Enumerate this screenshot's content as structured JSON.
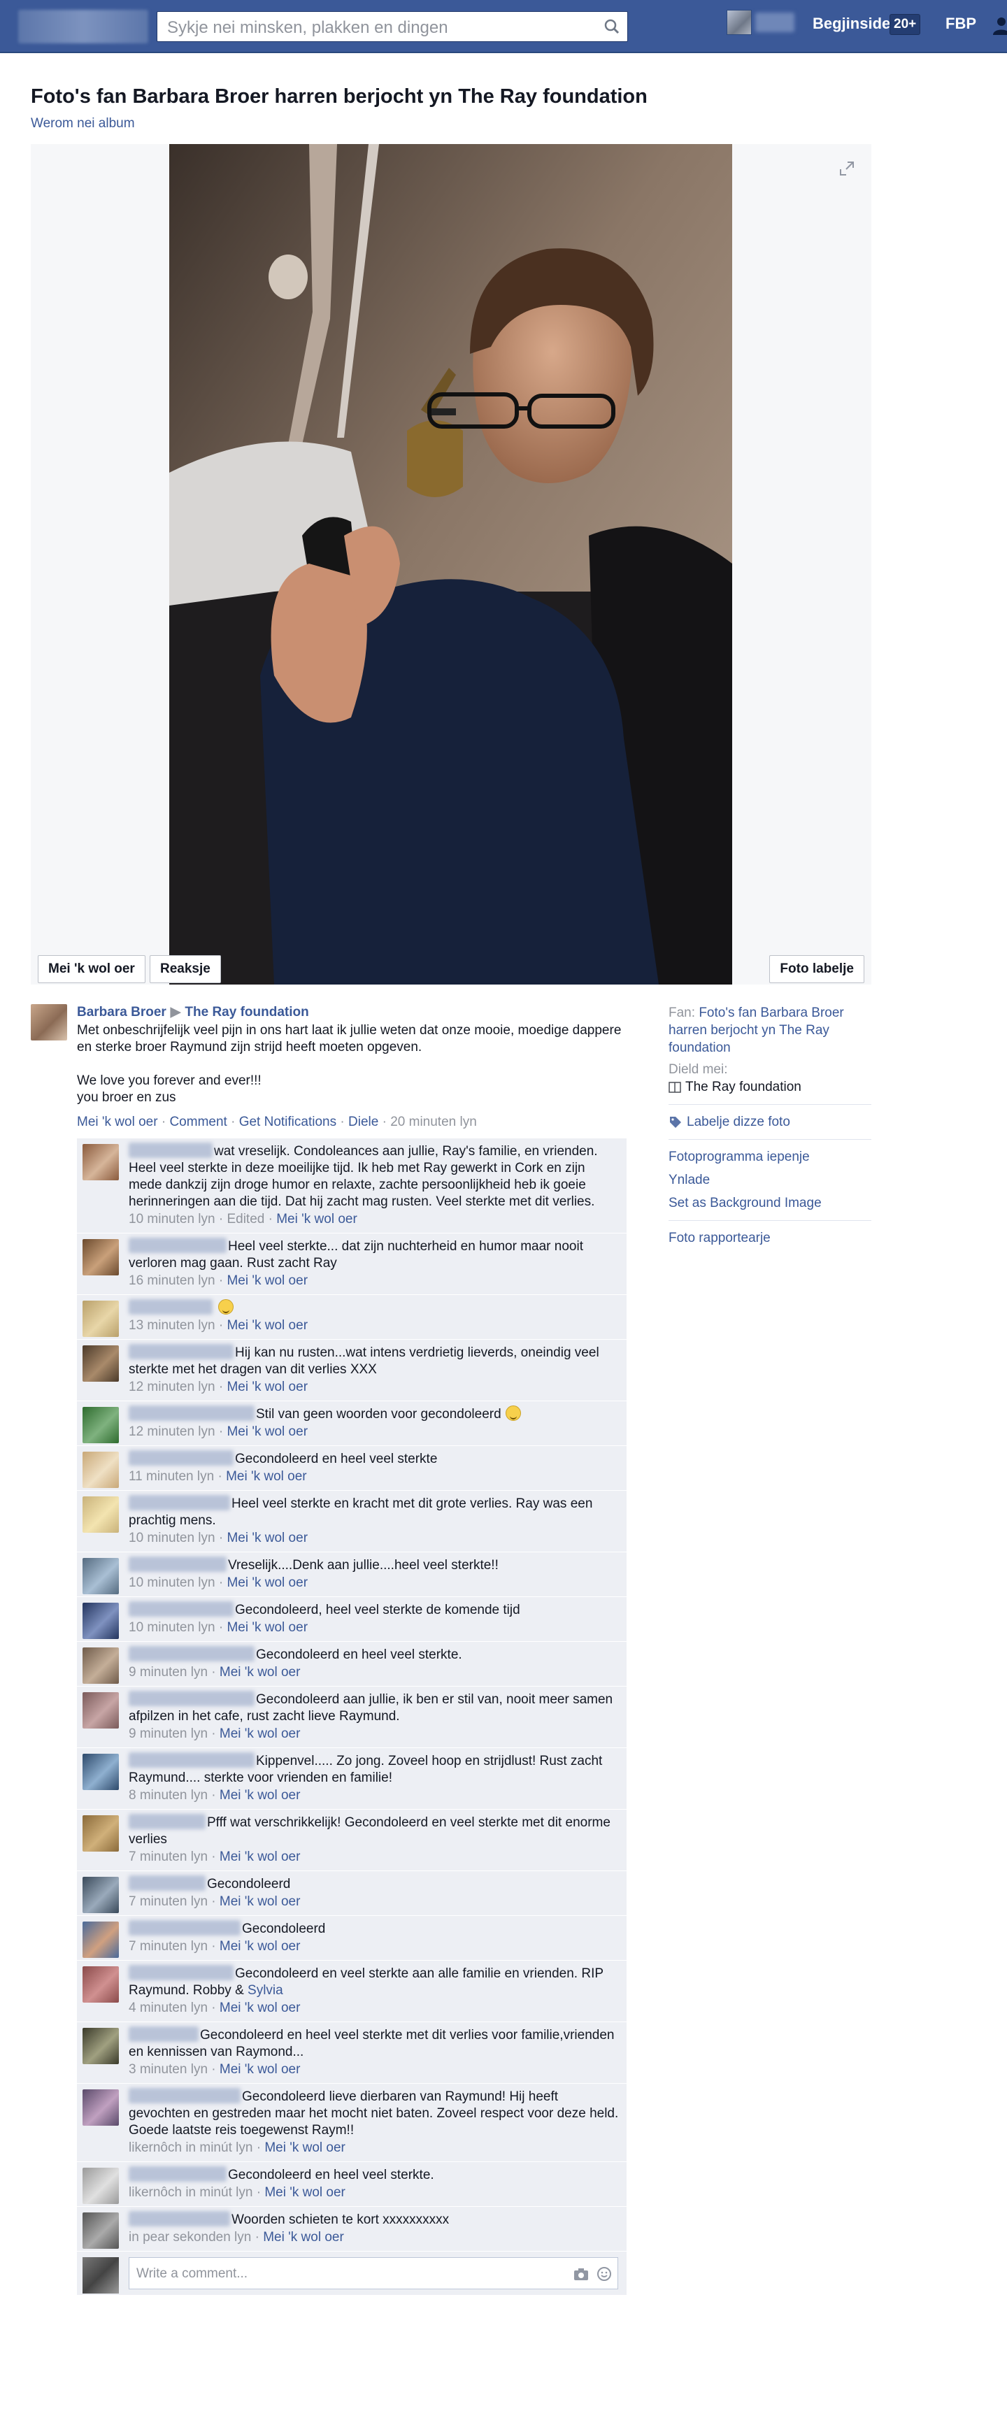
{
  "topbar": {
    "search_placeholder": "Sykje nei minsken, plakken en dingen",
    "home_label": "Begjinside",
    "home_badge": "20+",
    "profile_short": "FBP"
  },
  "header": {
    "title": "Foto's fan Barbara Broer harren berjocht yn The Ray foundation",
    "back_link": "Werom nei album"
  },
  "photo_actions": {
    "like": "Mei 'k wol oer",
    "react": "Reaksje",
    "tag": "Foto labelje"
  },
  "post": {
    "author": "Barbara Broer",
    "arrow": "▶",
    "group": "The Ray foundation",
    "body": "Met onbeschrijfelijk veel pijn in ons hart laat ik jullie weten dat onze mooie, moedige dappere en sterke broer Raymund zijn strijd heeft moeten opgeven.\n\nWe love you forever and ever!!!\nyou broer en zus",
    "actions": {
      "like": "Mei 'k wol oer",
      "comment": "Comment",
      "notifications": "Get Notifications",
      "share": "Diele",
      "sep": " · ",
      "time": "20 minuten lyn"
    }
  },
  "comments": [
    {
      "text": "wat vreselijk. Condoleances aan jullie, Ray's familie, en vrienden. Heel veel sterkte in deze moeilijke tijd. Ik heb met Ray gewerkt in Cork en zijn mede dankzij zijn droge humor en relaxte, zachte persoonlijkheid heb ik goeie herinneringen aan die tijd. Dat hij zacht mag rusten. Veel sterkte met dit verlies.",
      "time": "10 minuten lyn",
      "edited": "Edited",
      "like": "Mei 'k wol oer"
    },
    {
      "text": "Heel veel sterkte... dat zijn nuchterheid en humor maar nooit verloren mag gaan. Rust zacht Ray",
      "time": "16 minuten lyn",
      "like": "Mei 'k wol oer"
    },
    {
      "text": "",
      "emoji": true,
      "time": "13 minuten lyn",
      "like": "Mei 'k wol oer"
    },
    {
      "text": "Hij kan nu rusten...wat intens verdrietig lieverds, oneindig veel sterkte met het dragen van dit verlies XXX",
      "time": "12 minuten lyn",
      "like": "Mei 'k wol oer"
    },
    {
      "text": "Stil van geen woorden voor gecondoleerd",
      "emoji": true,
      "time": "12 minuten lyn",
      "like": "Mei 'k wol oer"
    },
    {
      "text": "Gecondoleerd en heel veel sterkte",
      "time": "11 minuten lyn",
      "like": "Mei 'k wol oer"
    },
    {
      "text": "Heel veel sterkte en kracht met dit grote verlies. Ray was een prachtig mens.",
      "time": "10 minuten lyn",
      "like": "Mei 'k wol oer"
    },
    {
      "text": "Vreselijk....Denk aan jullie....heel veel sterkte!!",
      "time": "10 minuten lyn",
      "like": "Mei 'k wol oer"
    },
    {
      "text": "Gecondoleerd, heel veel sterkte de komende tijd",
      "time": "10 minuten lyn",
      "like": "Mei 'k wol oer"
    },
    {
      "text": "Gecondoleerd en heel veel sterkte.",
      "time": "9 minuten lyn",
      "like": "Mei 'k wol oer"
    },
    {
      "text": "Gecondoleerd aan jullie, ik ben er stil van, nooit meer samen afpilzen in het cafe, rust zacht lieve Raymund.",
      "time": "9 minuten lyn",
      "like": "Mei 'k wol oer"
    },
    {
      "text": "Kippenvel..... Zo jong. Zoveel hoop en strijdlust! Rust zacht Raymund.... sterkte voor vrienden en familie!",
      "time": "8 minuten lyn",
      "like": "Mei 'k wol oer"
    },
    {
      "text": "Pfff wat verschrikkelijk! Gecondoleerd en veel sterkte met dit enorme verlies",
      "time": "7 minuten lyn",
      "like": "Mei 'k wol oer"
    },
    {
      "text": "Gecondoleerd",
      "time": "7 minuten lyn",
      "like": "Mei 'k wol oer"
    },
    {
      "text": "Gecondoleerd",
      "time": "7 minuten lyn",
      "like": "Mei 'k wol oer"
    },
    {
      "text": "Gecondoleerd en veel sterkte aan alle familie en vrienden. RIP Raymund. Robby &",
      "link": "Sylvia",
      "time": "4 minuten lyn",
      "like": "Mei 'k wol oer"
    },
    {
      "text": "Gecondoleerd en heel veel sterkte met dit verlies voor familie,vrienden en kennissen van Raymond...",
      "time": "3 minuten lyn",
      "like": "Mei 'k wol oer"
    },
    {
      "text": "Gecondoleerd lieve dierbaren van Raymund! Hij heeft gevochten en gestreden maar het mocht niet baten. Zoveel respect voor deze held.\nGoede laatste reis toegewenst Raym!!",
      "time": "likernôch in minút lyn",
      "like": "Mei 'k wol oer"
    },
    {
      "text": "Gecondoleerd en heel veel sterkte.",
      "time": "likernôch in minút lyn",
      "like": "Mei 'k wol oer"
    },
    {
      "text": "Woorden schieten te kort xxxxxxxxxx",
      "time": "in pear sekonden lyn",
      "like": "Mei 'k wol oer"
    }
  ],
  "write_comment_placeholder": "Write a comment...",
  "sidebar": {
    "from_label": "Fan:",
    "from_link": "Foto's fan Barbara Broer harren berjocht yn The Ray foundation",
    "shared_label": "Dield mei:",
    "shared_value": "The Ray foundation",
    "tag_photo": "Labelje dizze foto",
    "fotoprogramma": "Fotoprogramma iepenje",
    "download": "Ynlade",
    "background": "Set as Background Image",
    "report": "Foto rapportearje"
  }
}
